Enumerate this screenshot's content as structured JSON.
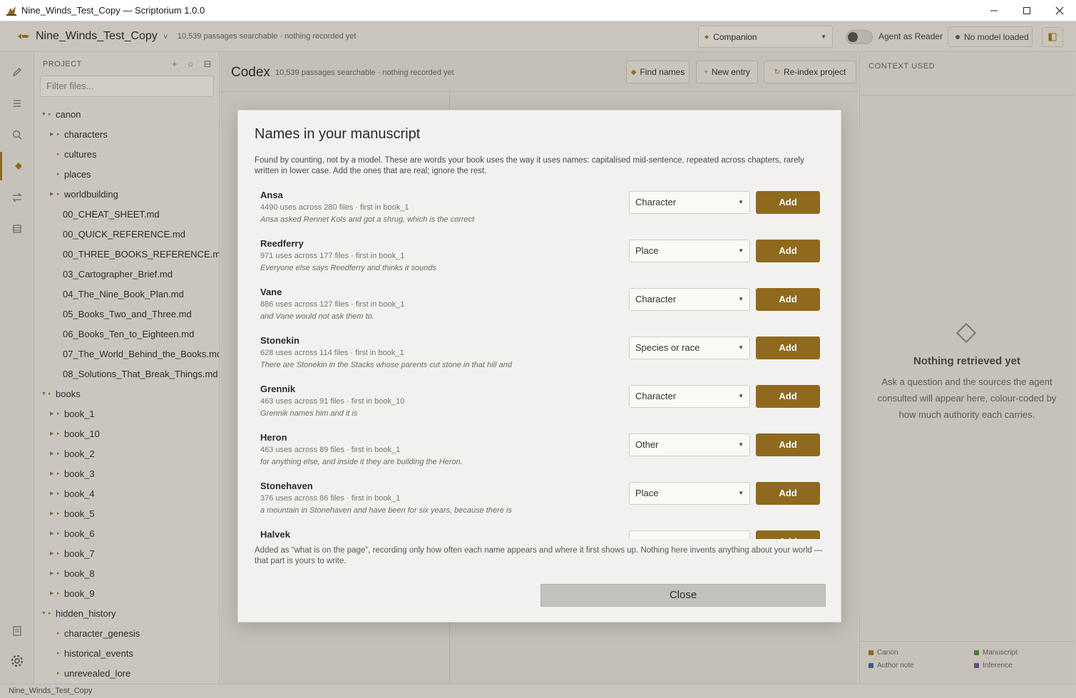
{
  "window": {
    "title": "Nine_Winds_Test_Copy — Scriptorium 1.0.0"
  },
  "header": {
    "project_name": "Nine_Winds_Test_Copy",
    "project_caret": "v",
    "stats": "10,539 passages searchable · nothing recorded yet",
    "companion_label": "Companion",
    "agent_label": "Agent as Reader",
    "model_label": "No model loaded"
  },
  "explorer": {
    "heading": "PROJECT",
    "filter_placeholder": "Filter files...",
    "tree": [
      {
        "label": "canon",
        "kind": "folder-open",
        "depth": 0
      },
      {
        "label": "characters",
        "kind": "folder",
        "depth": 1
      },
      {
        "label": "cultures",
        "kind": "item",
        "depth": 1
      },
      {
        "label": "places",
        "kind": "item",
        "depth": 1
      },
      {
        "label": "worldbuilding",
        "kind": "folder",
        "depth": 1
      },
      {
        "label": "00_CHEAT_SHEET.md",
        "kind": "file",
        "depth": 1
      },
      {
        "label": "00_QUICK_REFERENCE.md",
        "kind": "file",
        "depth": 1
      },
      {
        "label": "00_THREE_BOOKS_REFERENCE.md",
        "kind": "file",
        "depth": 1
      },
      {
        "label": "03_Cartographer_Brief.md",
        "kind": "file",
        "depth": 1
      },
      {
        "label": "04_The_Nine_Book_Plan.md",
        "kind": "file",
        "depth": 1
      },
      {
        "label": "05_Books_Two_and_Three.md",
        "kind": "file",
        "depth": 1
      },
      {
        "label": "06_Books_Ten_to_Eighteen.md",
        "kind": "file",
        "depth": 1
      },
      {
        "label": "07_The_World_Behind_the_Books.md",
        "kind": "file",
        "depth": 1
      },
      {
        "label": "08_Solutions_That_Break_Things.md",
        "kind": "file",
        "depth": 1
      },
      {
        "label": "books",
        "kind": "folder-open",
        "depth": 0
      },
      {
        "label": "book_1",
        "kind": "folder",
        "depth": 1
      },
      {
        "label": "book_10",
        "kind": "folder",
        "depth": 1
      },
      {
        "label": "book_2",
        "kind": "folder",
        "depth": 1
      },
      {
        "label": "book_3",
        "kind": "folder",
        "depth": 1
      },
      {
        "label": "book_4",
        "kind": "folder",
        "depth": 1
      },
      {
        "label": "book_5",
        "kind": "folder",
        "depth": 1
      },
      {
        "label": "book_6",
        "kind": "folder",
        "depth": 1
      },
      {
        "label": "book_7",
        "kind": "folder",
        "depth": 1
      },
      {
        "label": "book_8",
        "kind": "folder",
        "depth": 1
      },
      {
        "label": "book_9",
        "kind": "folder",
        "depth": 1
      },
      {
        "label": "hidden_history",
        "kind": "folder-open",
        "depth": 0
      },
      {
        "label": "character_genesis",
        "kind": "item",
        "depth": 1
      },
      {
        "label": "historical_events",
        "kind": "item",
        "depth": 1
      },
      {
        "label": "unrevealed_lore",
        "kind": "item",
        "depth": 1
      }
    ]
  },
  "codex": {
    "title": "Codex",
    "stats": "10,539 passages searchable · nothing recorded yet",
    "find_names": "Find names",
    "new_entry": "New entry",
    "reindex": "Re-index project"
  },
  "context": {
    "heading": "CONTEXT USED",
    "empty_title": "Nothing retrieved yet",
    "empty_text": "Ask a question and the sources the agent consulted will appear here, colour-coded by how much authority each carries.",
    "legend": [
      {
        "label": "Canon",
        "color": "#8a6a1f"
      },
      {
        "label": "Manuscript",
        "color": "#4f7a3a"
      },
      {
        "label": "Author note",
        "color": "#3a5f8a"
      },
      {
        "label": "Inference",
        "color": "#6a4a8a"
      }
    ]
  },
  "modal": {
    "title": "Names in your manuscript",
    "intro": "Found by counting, not by a model. These are words your book uses the way it uses names: capitalised mid-sentence, repeated across chapters, rarely written in lower case. Add the ones that are real; ignore the rest.",
    "add_label": "Add",
    "names": [
      {
        "name": "Ansa",
        "meta": "4490 uses across 280 files · first in book_1",
        "quote": "Ansa asked Rennet Kols and got a shrug, which is the correct",
        "type": "Character"
      },
      {
        "name": "Reedferry",
        "meta": "971 uses across 177 files · first in book_1",
        "quote": "Everyone else says Reedferry and thinks it sounds",
        "type": "Place"
      },
      {
        "name": "Vane",
        "meta": "886 uses across 127 files · first in book_1",
        "quote": "and Vane would not ask them to.",
        "type": "Character"
      },
      {
        "name": "Stonekin",
        "meta": "628 uses across 114 files · first in book_1",
        "quote": "There are Stonekin in the Stacks whose parents cut stone in that hill and",
        "type": "Species or race"
      },
      {
        "name": "Grennik",
        "meta": "463 uses across 91 files · first in book_10",
        "quote": "Grennik names him and it is",
        "type": "Character"
      },
      {
        "name": "Heron",
        "meta": "463 uses across 89 files · first in book_1",
        "quote": "for anything else, and inside it they are building the Heron.",
        "type": "Other"
      },
      {
        "name": "Stonehaven",
        "meta": "376 uses across 86 files · first in book_1",
        "quote": "a mountain in Stonehaven and have been for six years, because there is",
        "type": "Place"
      },
      {
        "name": "Halvek",
        "meta": "",
        "quote": "",
        "type": ""
      }
    ],
    "footer": "Added as “what is on the page”, recording only how often each name appears and where it first shows up. Nothing here invents anything about your world — that part is yours to write.",
    "close_label": "Close"
  },
  "statusbar": {
    "text": "Nine_Winds_Test_Copy"
  }
}
